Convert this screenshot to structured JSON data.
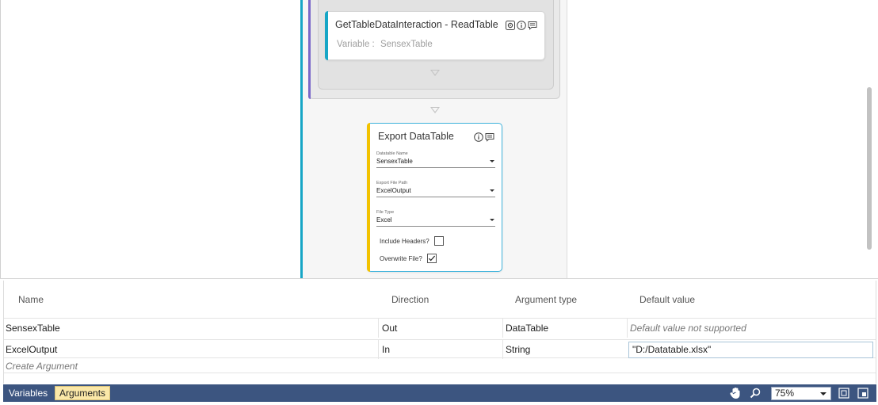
{
  "designer": {
    "read_activity": {
      "title": "GetTableDataInteraction - ReadTable",
      "variable_label": "Variable :",
      "variable_value": "SensexTable",
      "icons": [
        "settings-icon",
        "info-icon",
        "comment-icon"
      ]
    },
    "export_activity": {
      "title": "Export DataTable",
      "icons": [
        "info-icon",
        "comment-icon"
      ],
      "fields": [
        {
          "label": "Datatable Name",
          "value": "SensexTable"
        },
        {
          "label": "Export File Path",
          "value": "ExcelOutput"
        },
        {
          "label": "File Type",
          "value": "Excel"
        }
      ],
      "include_headers": {
        "label": "Include Headers?",
        "checked": false
      },
      "overwrite_file": {
        "label": "Overwrite File?",
        "checked": true
      }
    },
    "colors": {
      "sequence_accent": "#17a6c6",
      "container_accent": "#7b68c9",
      "export_accent": "#f2c200",
      "selected_border": "#41b4dc"
    }
  },
  "arguments": {
    "columns": [
      "Name",
      "Direction",
      "Argument type",
      "Default value"
    ],
    "rows": [
      {
        "name": "SensexTable",
        "direction": "Out",
        "type": "DataTable",
        "default": "Default value not supported"
      },
      {
        "name": "ExcelOutput",
        "direction": "In",
        "type": "String",
        "default": "\"D:/Datatable.xlsx\""
      }
    ],
    "create_label": "Create Argument"
  },
  "statusbar": {
    "tabs": [
      "Variables",
      "Arguments"
    ],
    "active_tab": "Arguments",
    "zoom": "75%",
    "icons": [
      "hand-pan-icon",
      "zoom-icon",
      "fit-screen-icon",
      "overview-icon"
    ],
    "color": "#3c5580"
  }
}
